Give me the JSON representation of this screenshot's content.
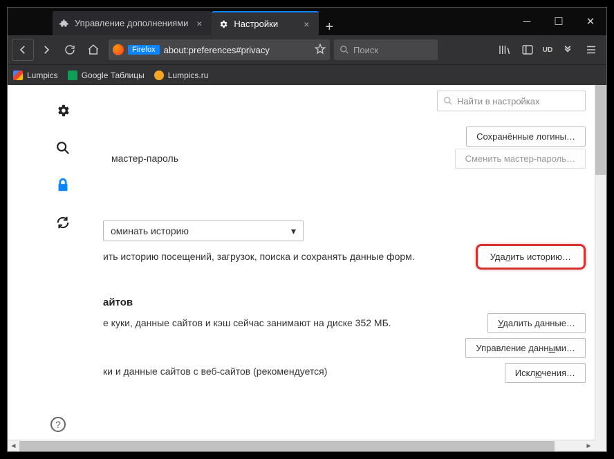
{
  "tabs": [
    {
      "label": "Управление дополнениями",
      "active": false,
      "icon": "puzzle"
    },
    {
      "label": "Настройки",
      "active": true,
      "icon": "gear"
    }
  ],
  "urlbar": {
    "badge": "Firefox",
    "url": "about:preferences#privacy"
  },
  "searchbar": {
    "placeholder": "Поиск"
  },
  "bookmarks": [
    {
      "label": "Lumpics",
      "color": "#333",
      "iconColor": "linear"
    },
    {
      "label": "Google Таблицы",
      "color": "#0f9d58"
    },
    {
      "label": "Lumpics.ru",
      "color": "#f5a623"
    }
  ],
  "settings": {
    "search_placeholder": "Найти в настройках",
    "saved_logins_btn": "Сохранённые логины…",
    "master_password_label": "мастер-пароль",
    "change_master_btn": "Сменить мастер-пароль…",
    "history_dropdown": "оминать историю",
    "history_desc": "ить историю посещений, загрузок, поиска и сохранять данные форм.",
    "clear_history_btn_pre": "Уда",
    "clear_history_btn_u": "л",
    "clear_history_btn_post": "ить историю…",
    "sites_title": "айтов",
    "sites_desc": "е куки, данные сайтов и кэш сейчас занимают на диске 352 МБ.",
    "clear_data_btn_pre": "",
    "clear_data_btn_u": "У",
    "clear_data_btn_post": "далить данные…",
    "manage_data_btn_pre": "Управление данн",
    "manage_data_btn_u": "ы",
    "manage_data_btn_post": "ми…",
    "cookies_desc": "ки и данные сайтов с веб-сайтов (рекомендуется)",
    "exceptions_btn_pre": "Искл",
    "exceptions_btn_u": "ю",
    "exceptions_btn_post": "чения…"
  }
}
